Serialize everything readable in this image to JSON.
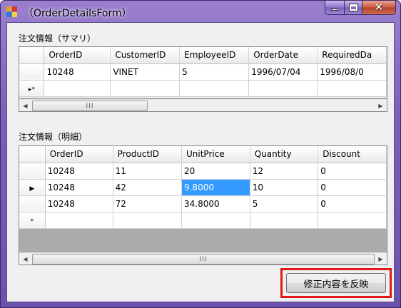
{
  "window": {
    "title": "（OrderDetailsForm）"
  },
  "summary": {
    "label": "注文情報（サマリ）",
    "columns": [
      "OrderID",
      "CustomerID",
      "EmployeeID",
      "OrderDate",
      "RequiredDa"
    ],
    "rows": [
      [
        "10248",
        "VINET",
        "5",
        "1996/07/04",
        "1996/08/0"
      ]
    ],
    "new_row_glyph": "▸*"
  },
  "details": {
    "label": "注文情報（明細）",
    "columns": [
      "OrderID",
      "ProductID",
      "UnitPrice",
      "Quantity",
      "Discount"
    ],
    "rows": [
      [
        "10248",
        "11",
        "20",
        "12",
        "0"
      ],
      [
        "10248",
        "42",
        "9.8000",
        "10",
        "0"
      ],
      [
        "10248",
        "72",
        "34.8000",
        "5",
        "0"
      ]
    ],
    "current_row_glyph": "▶",
    "new_row_glyph": "*"
  },
  "scrollbar": {
    "left_arrow": "◀",
    "right_arrow": "▶",
    "thumb_grip": "III"
  },
  "actions": {
    "apply_label": "修正内容を反映"
  }
}
